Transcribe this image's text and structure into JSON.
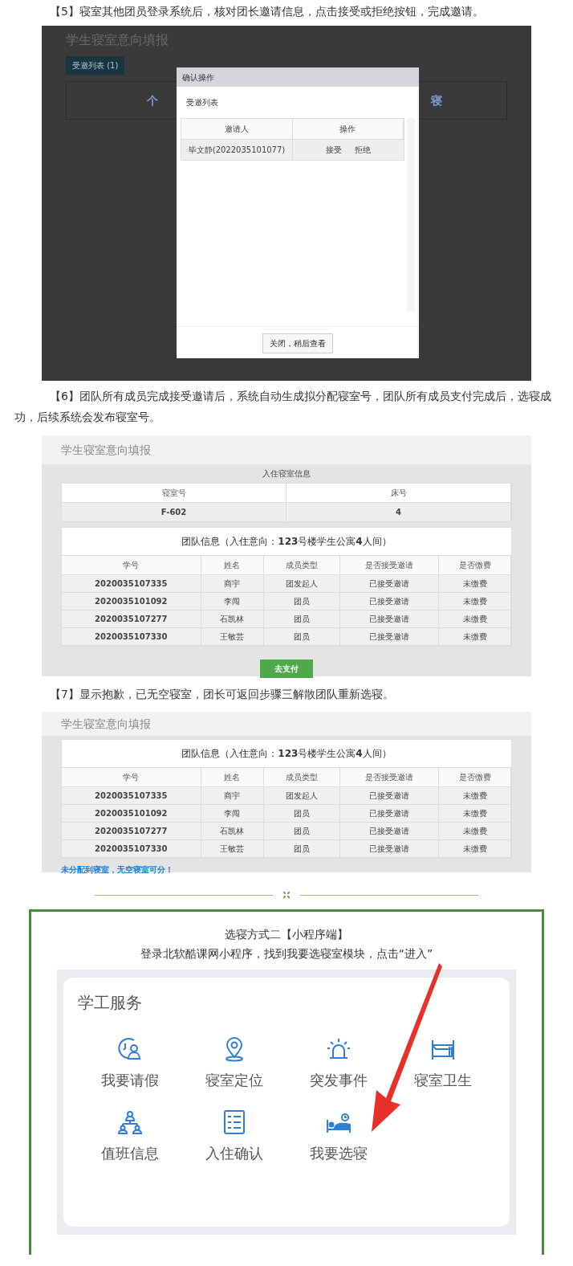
{
  "step5": {
    "caption": "【5】寝室其他团员登录系统后，核对团长邀请信息，点击接受或拒绝按钮，完成邀请。",
    "screen": {
      "page_title": "学生寝室意向填报",
      "invite_button": "受邀列表 (1)",
      "hidden_left": "个",
      "hidden_right": "寝",
      "dialog": {
        "title": "确认操作",
        "heading": "受邀列表",
        "columns": [
          "邀请人",
          "操作"
        ],
        "rows": [
          {
            "inviter": "毕文静(2022035101077)",
            "accept": "接受",
            "reject": "拒绝"
          }
        ],
        "close_button": "关闭，稍后查看"
      }
    }
  },
  "step6": {
    "caption": "【6】团队所有成员完成接受邀请后，系统自动生成拟分配寝室号，团队所有成员支付完成后，选寝成功，后续系统会发布寝室号。",
    "screen": {
      "page_title": "学生寝室意向填报",
      "room_heading": "入住寝室信息",
      "room_columns": [
        "寝室号",
        "床号"
      ],
      "room_values": [
        "F-602",
        "4"
      ],
      "team_heading": "团队信息（入住意向：**123**号楼学生公寓**4**人间）",
      "columns": [
        "学号",
        "姓名",
        "成员类型",
        "是否接受邀请",
        "是否缴费"
      ],
      "rows": [
        [
          "2020035107335",
          "商宇",
          "团发起人",
          "已接受邀请",
          "未缴费"
        ],
        [
          "2020035101092",
          "李闯",
          "团员",
          "已接受邀请",
          "未缴费"
        ],
        [
          "2020035107277",
          "石凯林",
          "团员",
          "已接受邀请",
          "未缴费"
        ],
        [
          "2020035107330",
          "王敏芸",
          "团员",
          "已接受邀请",
          "未缴费"
        ]
      ],
      "pay_button": "去支付"
    }
  },
  "step7": {
    "caption": "【7】显示抱歉，已无空寝室，团长可返回步骤三解散团队重新选寝。",
    "screen": {
      "page_title": "学生寝室意向填报",
      "team_heading": "团队信息（入住意向：**123**号楼学生公寓**4**人间）",
      "columns": [
        "学号",
        "姓名",
        "成员类型",
        "是否接受邀请",
        "是否缴费"
      ],
      "rows": [
        [
          "2020035107335",
          "商宇",
          "团发起人",
          "已接受邀请",
          "未缴费"
        ],
        [
          "2020035101092",
          "李闯",
          "团员",
          "已接受邀请",
          "未缴费"
        ],
        [
          "2020035107277",
          "石凯林",
          "团员",
          "已接受邀请",
          "未缴费"
        ],
        [
          "2020035107330",
          "王敏芸",
          "团员",
          "已接受邀请",
          "未缴费"
        ]
      ],
      "notice": "未分配到寝室，无空寝室可分！"
    }
  },
  "method2": {
    "title": "选寝方式二【小程序端】",
    "instruction": "登录北软酷课网小程序，找到我要选寝室模块，点击“进入”",
    "app": {
      "section_title": "学工服务",
      "items": [
        {
          "kind": "leave",
          "label": "我要请假"
        },
        {
          "kind": "location",
          "label": "寝室定位"
        },
        {
          "kind": "alarm",
          "label": "突发事件"
        },
        {
          "kind": "bed",
          "label": "寝室卫生"
        },
        {
          "kind": "org",
          "label": "值班信息"
        },
        {
          "kind": "list",
          "label": "入住确认"
        },
        {
          "kind": "sleep",
          "label": "我要选寝"
        }
      ]
    }
  }
}
